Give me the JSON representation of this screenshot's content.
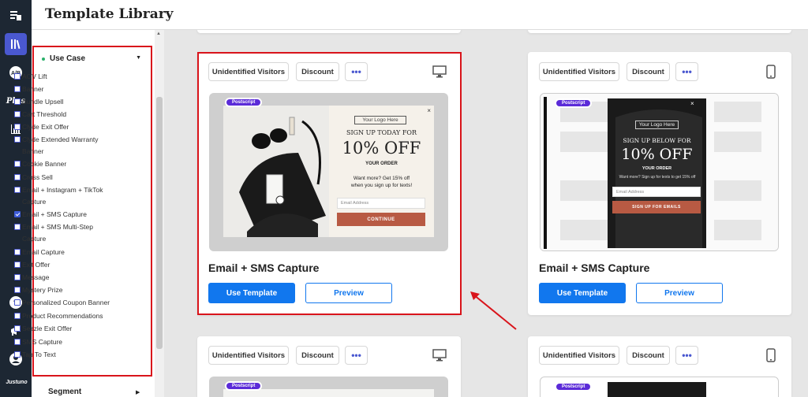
{
  "app": {
    "title": "Template Library",
    "logo": "Justuno",
    "rail_items": [
      {
        "icon": "dashboard-icon"
      },
      {
        "icon": "library-icon"
      },
      {
        "icon": "ab-test-icon",
        "label": "A/B"
      },
      {
        "icon": "plus-icon",
        "label": "Plus"
      },
      {
        "icon": "analytics-icon"
      },
      {
        "icon": "help-icon"
      },
      {
        "icon": "announcement-icon"
      },
      {
        "icon": "account-icon"
      }
    ]
  },
  "filters": {
    "use_case_label": "Use Case",
    "options": [
      {
        "label": "AOV Lift",
        "checked": false
      },
      {
        "label": "Banner",
        "checked": false
      },
      {
        "label": "Bundle Upsell",
        "checked": false
      },
      {
        "label": "Cart Threshold",
        "checked": false
      },
      {
        "label": "Clyde Exit Offer",
        "checked": false
      },
      {
        "label": "Clyde Extended Warranty Banner",
        "checked": false
      },
      {
        "label": "Cookie Banner",
        "checked": false
      },
      {
        "label": "Cross Sell",
        "checked": false
      },
      {
        "label": "Email + Instagram + TikTok Capture",
        "checked": false
      },
      {
        "label": "Email + SMS Capture",
        "checked": true
      },
      {
        "label": "Email + SMS Multi-Step Capture",
        "checked": false
      },
      {
        "label": "Email Capture",
        "checked": false
      },
      {
        "label": "Exit Offer",
        "checked": false
      },
      {
        "label": "Message",
        "checked": false
      },
      {
        "label": "Mystery Prize",
        "checked": false
      },
      {
        "label": "Personalized Coupon Banner",
        "checked": false
      },
      {
        "label": "Product Recommendations",
        "checked": false
      },
      {
        "label": "Sezzle Exit Offer",
        "checked": false
      },
      {
        "label": "SMS Capture",
        "checked": false
      },
      {
        "label": "Tap To Text",
        "checked": false
      }
    ],
    "segment_label": "Segment"
  },
  "tags": {
    "visitors": "Unidentified Visitors",
    "discount": "Discount",
    "more": "•••"
  },
  "cards": [
    {
      "title": "Email + SMS Capture",
      "device": "desktop-icon",
      "use_label": "Use Template",
      "preview_label": "Preview",
      "popup": {
        "badge": "Postscript",
        "logo": "Your Logo Here",
        "headline": "SIGN UP TODAY FOR",
        "offer": "10% OFF",
        "subline": "YOUR ORDER",
        "body1": "Want more? Get 15% off",
        "body2": "when you sign up for texts!",
        "input_placeholder": "Email Address",
        "cta": "CONTINUE",
        "close": "×"
      }
    },
    {
      "title": "Email + SMS Capture",
      "device": "mobile-icon",
      "use_label": "Use Template",
      "preview_label": "Preview",
      "popup": {
        "badge": "Postscript",
        "logo": "Your Logo Here",
        "headline": "SIGN UP BELOW FOR",
        "offer": "10% OFF",
        "subline": "YOUR ORDER",
        "body1": "Want more? Sign up for texts to get 15% off",
        "input_placeholder": "Email Address",
        "cta": "SIGN UP FOR EMAILS",
        "close": "×"
      }
    },
    {
      "device": "desktop-icon",
      "popup": {
        "badge": "Postscript"
      }
    },
    {
      "device": "mobile-icon",
      "popup": {
        "badge": "Postscript"
      }
    }
  ],
  "colors": {
    "accent": "#1177ee",
    "rail": "#1d2733",
    "highlight": "#d9141b",
    "cta": "#b85a43",
    "badge": "#5b2bd8"
  }
}
